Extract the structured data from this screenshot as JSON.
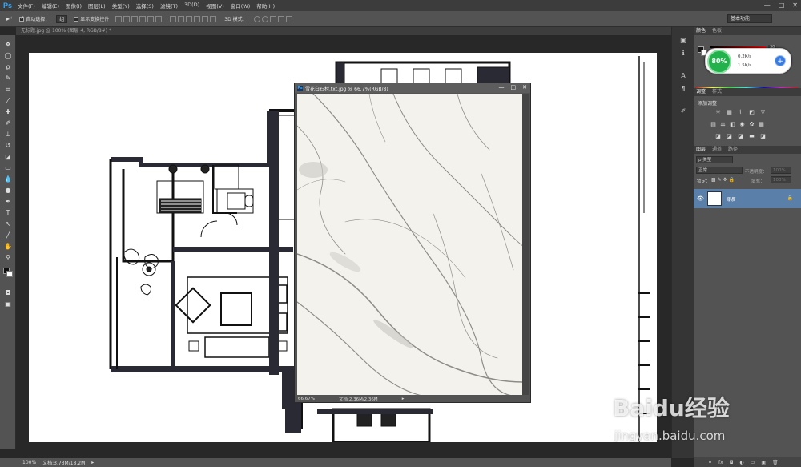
{
  "app": {
    "logo": "Ps"
  },
  "menu": [
    "文件(F)",
    "编辑(E)",
    "图像(I)",
    "图层(L)",
    "类型(Y)",
    "选择(S)",
    "滤镜(T)",
    "3D(D)",
    "视图(V)",
    "窗口(W)",
    "帮助(H)"
  ],
  "window_controls": [
    "—",
    "□",
    "✕"
  ],
  "options": {
    "auto_select_label": "自动选择：",
    "auto_select_value": "组",
    "transform_label": "显示变换控件",
    "mode_3d_label": "3D 模式：",
    "workspace": "基本功能"
  },
  "document_tab": {
    "title": "无标题.jpg @ 100% (图层 4, RGB/8#) *"
  },
  "status": {
    "zoom": "100%",
    "doc": "文档:3.73M/18.2M"
  },
  "float_window": {
    "title": "雪花白石材.txt.jpg @ 66.7%(RGB/8)",
    "zoom": "66.67%",
    "doc": "文档:2.36M/2.36M"
  },
  "panels": {
    "color_tabs": [
      "颜色",
      "色板"
    ],
    "slider_values": [
      "30",
      "",
      ""
    ],
    "adjust_tabs": [
      "调整",
      "样式"
    ],
    "adjust_title": "添加调整",
    "layers_tabs": [
      "图层",
      "通道",
      "路径"
    ],
    "kind_label": "ρ 类型",
    "blend_mode": "正常",
    "opacity_label": "不透明度：",
    "opacity_value": "100%",
    "lock_label": "锁定：",
    "fill_label": "填充：",
    "fill_value": "100%",
    "layer_name": "背景"
  },
  "net_widget": {
    "percent": "80%",
    "up": "0.2K/s",
    "down": "1.5K/s",
    "plus": "+"
  },
  "watermark": {
    "main": "Baidu经验",
    "sub": "jingyan.baidu.com"
  }
}
